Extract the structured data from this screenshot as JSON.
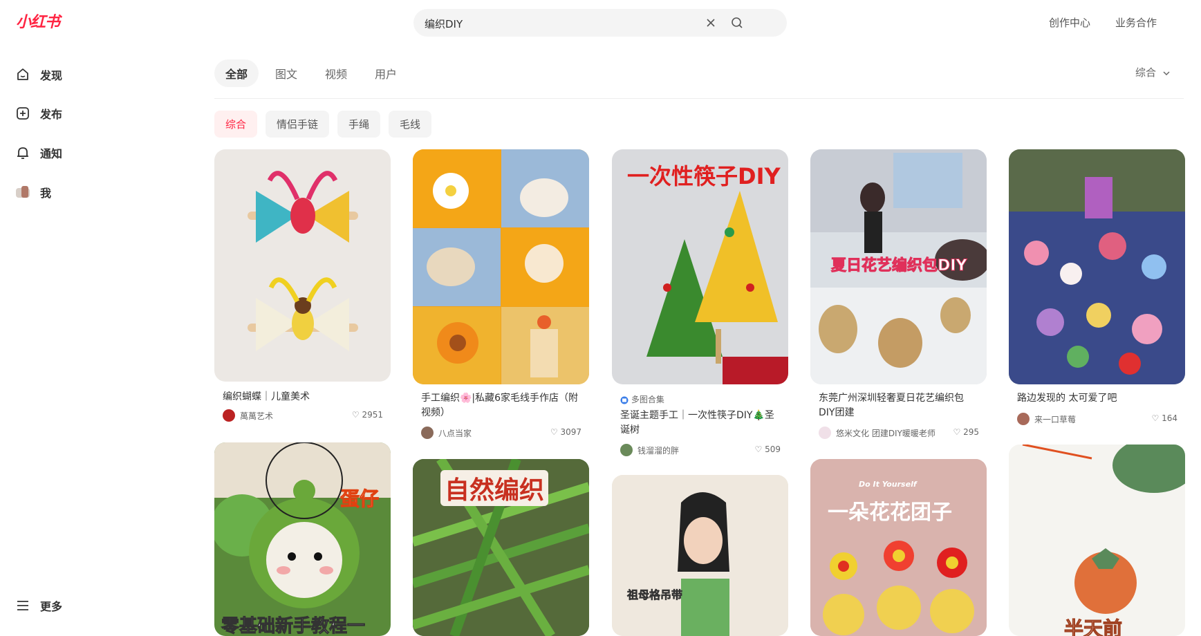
{
  "brand": {
    "logo": "小红书",
    "color": "#ff2442"
  },
  "search": {
    "query": "编织DIY"
  },
  "header_links": [
    "创作中心",
    "业务合作"
  ],
  "sidebar": {
    "items": [
      {
        "label": "发现",
        "icon": "home-icon"
      },
      {
        "label": "发布",
        "icon": "add-icon"
      },
      {
        "label": "通知",
        "icon": "bell-icon"
      },
      {
        "label": "我",
        "icon": "avatar-icon"
      }
    ],
    "more": "更多"
  },
  "tabs": [
    "全部",
    "图文",
    "视频",
    "用户"
  ],
  "active_tab": "全部",
  "sort": "综合",
  "filters": [
    "综合",
    "情侣手链",
    "手绳",
    "毛线"
  ],
  "active_filter": "综合",
  "cards": [
    {
      "title": "编织蝴蝶｜儿童美术",
      "author": "萬萬艺术",
      "likes": "2951",
      "overlay": ""
    },
    {
      "title": "手工编织🌸|私藏6家毛线手作店（附视频）",
      "author": "八点当家",
      "likes": "3097",
      "overlay": ""
    },
    {
      "tag": "多图合集",
      "title": "圣诞主题手工｜一次性筷子DIY🎄圣诞树",
      "author": "钱溜溜的胖",
      "likes": "509",
      "overlay": "一次性筷子DIY"
    },
    {
      "title": "东莞广州深圳轻奢夏日花艺编织包DIY团建",
      "author": "悠米文化 团建DIY暖暖老师",
      "likes": "295",
      "overlay": "夏日花艺编织包DIY"
    },
    {
      "title": "路边发现的 太可爱了吧",
      "author": "来一口草莓",
      "likes": "164",
      "overlay": ""
    },
    {
      "overlay": "零基础新手教程一",
      "overlay2": "蛋仔"
    },
    {
      "overlay": "自然编织"
    },
    {
      "overlay": "祖母格吊带"
    },
    {
      "overlay": "一朵花花团子",
      "overlay2": "Do It Yourself"
    },
    {
      "overlay": "半天前"
    }
  ]
}
